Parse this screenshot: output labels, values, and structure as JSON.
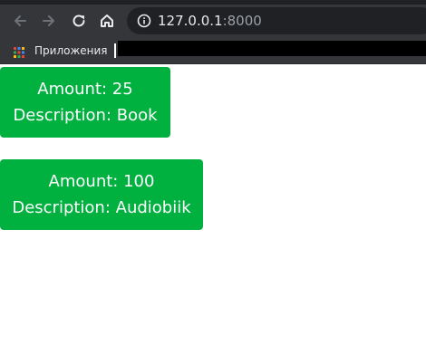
{
  "browser": {
    "url_host": "127.0.0.1",
    "url_port": ":8000",
    "bookmarks_bar": {
      "apps_label": "Приложения"
    },
    "icons": [
      "back-arrow-icon",
      "forward-arrow-icon",
      "reload-icon",
      "home-icon",
      "info-icon",
      "apps-grid-icon"
    ]
  },
  "cards": [
    {
      "amount": "Amount: 25",
      "description": "Description: Book"
    },
    {
      "amount": "Amount: 100",
      "description": "Description: Audiobiik"
    }
  ],
  "colors": {
    "card_background": "#00b140",
    "toolbar_background": "#35363a",
    "omnibox_background": "#202124"
  }
}
